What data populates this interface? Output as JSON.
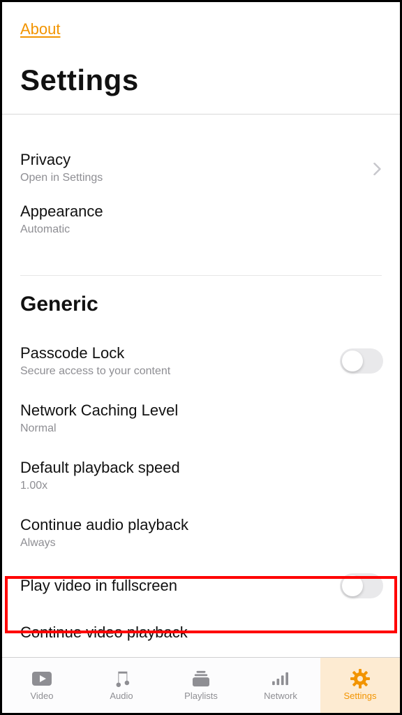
{
  "header": {
    "about_label": "About",
    "title": "Settings"
  },
  "privacy": {
    "title": "Privacy",
    "sub": "Open in Settings"
  },
  "appearance": {
    "title": "Appearance",
    "sub": "Automatic"
  },
  "generic": {
    "heading": "Generic",
    "passcode": {
      "title": "Passcode Lock",
      "sub": "Secure access to your content",
      "on": false
    },
    "caching": {
      "title": "Network Caching Level",
      "sub": "Normal"
    },
    "speed": {
      "title": "Default playback speed",
      "sub": "1.00x"
    },
    "audio_cont": {
      "title": "Continue audio playback",
      "sub": "Always"
    },
    "fullscreen": {
      "title": "Play video in fullscreen",
      "on": false
    },
    "video_cont": {
      "title": "Continue video playback"
    }
  },
  "tabs": {
    "video": "Video",
    "audio": "Audio",
    "playlists": "Playlists",
    "network": "Network",
    "settings": "Settings"
  }
}
